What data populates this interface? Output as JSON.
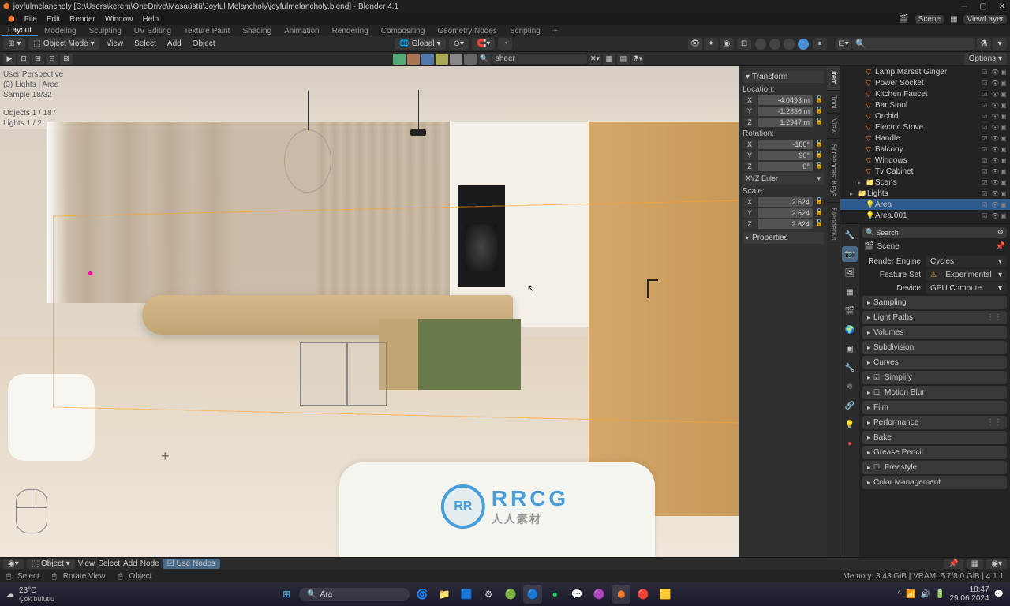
{
  "window": {
    "title": "joyfulmelancholy [C:\\Users\\kerem\\OneDrive\\Masaüstü\\Joyful Melancholy\\joyfulmelancholy.blend] - Blender 4.1"
  },
  "menu": [
    "File",
    "Edit",
    "Render",
    "Window",
    "Help"
  ],
  "workspaces": [
    "Layout",
    "Modeling",
    "Sculpting",
    "UV Editing",
    "Texture Paint",
    "Shading",
    "Animation",
    "Rendering",
    "Compositing",
    "Geometry Nodes",
    "Scripting"
  ],
  "workspace_active": "Layout",
  "scene_menu": {
    "scene_label": "Scene",
    "viewlayer_label": "ViewLayer"
  },
  "toolbar": {
    "mode": "Object Mode",
    "menus": [
      "View",
      "Select",
      "Add",
      "Object"
    ],
    "orientation": "Global",
    "options_label": "Options"
  },
  "material_search": "sheer",
  "viewport_overlay": {
    "line1": "User Perspective",
    "line2": "(3) Lights | Area",
    "line3": "Sample 18/32",
    "line4": "Objects    1 / 187",
    "line5": "Lights     1 / 2"
  },
  "npanel": {
    "tabs": [
      "Item",
      "Tool",
      "View",
      "Screencast Keys",
      "BlenderKit"
    ],
    "tab_active": "Item",
    "transform_label": "Transform",
    "location_label": "Location:",
    "location": {
      "x": "-4.0493 m",
      "y": "-1.2336 m",
      "z": "1.2947 m"
    },
    "rotation_label": "Rotation:",
    "rotation": {
      "x": "-180°",
      "y": "90°",
      "z": "0°"
    },
    "rotation_mode": "XYZ Euler",
    "scale_label": "Scale:",
    "scale": {
      "x": "2.624",
      "y": "2.624",
      "z": "2.624"
    },
    "properties_label": "Properties"
  },
  "outliner": {
    "search_placeholder": "",
    "items": [
      {
        "name": "Lamp Marset Ginger",
        "type": "mesh",
        "indent": 2
      },
      {
        "name": "Power Socket",
        "type": "mesh",
        "indent": 2
      },
      {
        "name": "Kitchen Faucet",
        "type": "mesh",
        "indent": 2
      },
      {
        "name": "Bar Stool",
        "type": "mesh",
        "indent": 2
      },
      {
        "name": "Orchid",
        "type": "mesh",
        "indent": 2
      },
      {
        "name": "Electric Stove",
        "type": "mesh",
        "indent": 2
      },
      {
        "name": "Handle",
        "type": "mesh",
        "indent": 2
      },
      {
        "name": "Balcony",
        "type": "mesh",
        "indent": 2
      },
      {
        "name": "Windows",
        "type": "mesh",
        "indent": 2
      },
      {
        "name": "Tv Cabinet",
        "type": "mesh",
        "indent": 2
      },
      {
        "name": "Scans",
        "type": "collection",
        "indent": 2
      },
      {
        "name": "Lights",
        "type": "collection",
        "indent": 1
      },
      {
        "name": "Area",
        "type": "light",
        "indent": 2,
        "selected": true
      },
      {
        "name": "Area.001",
        "type": "light",
        "indent": 2
      }
    ]
  },
  "properties": {
    "search_placeholder": "Search",
    "scene_breadcrumb": "Scene",
    "render_engine_label": "Render Engine",
    "render_engine": "Cycles",
    "feature_set_label": "Feature Set",
    "feature_set": "Experimental",
    "device_label": "Device",
    "device": "GPU Compute",
    "sections": [
      {
        "label": "Sampling",
        "check": false
      },
      {
        "label": "Light Paths",
        "check": false,
        "dots": true
      },
      {
        "label": "Volumes",
        "check": false
      },
      {
        "label": "Subdivision",
        "check": false
      },
      {
        "label": "Curves",
        "check": false
      },
      {
        "label": "Simplify",
        "check": true
      },
      {
        "label": "Motion Blur",
        "check": false,
        "checkbox_empty": true
      },
      {
        "label": "Film",
        "check": false
      },
      {
        "label": "Performance",
        "check": false,
        "dots": true
      },
      {
        "label": "Bake",
        "check": false
      },
      {
        "label": "Grease Pencil",
        "check": false
      },
      {
        "label": "Freestyle",
        "check": false,
        "checkbox_empty": true
      },
      {
        "label": "Color Management",
        "check": false
      }
    ]
  },
  "bottom_toolbar": {
    "context": "Object",
    "menus": [
      "View",
      "Select",
      "Add",
      "Node"
    ],
    "use_nodes": "Use Nodes"
  },
  "status_bar": {
    "select": "Select",
    "rotate": "Rotate View",
    "object": "Object",
    "memory": "Memory: 3.43 GiB | VRAM: 5.7/8.0 GiB | 4.1.1"
  },
  "taskbar": {
    "weather_temp": "23°C",
    "weather_desc": "Çok bulutlu",
    "search_placeholder": "Ara",
    "time": "18:47",
    "date": "29.06.2024"
  },
  "watermark": {
    "initials": "RR",
    "main": "RRCG",
    "sub": "人人素材"
  }
}
